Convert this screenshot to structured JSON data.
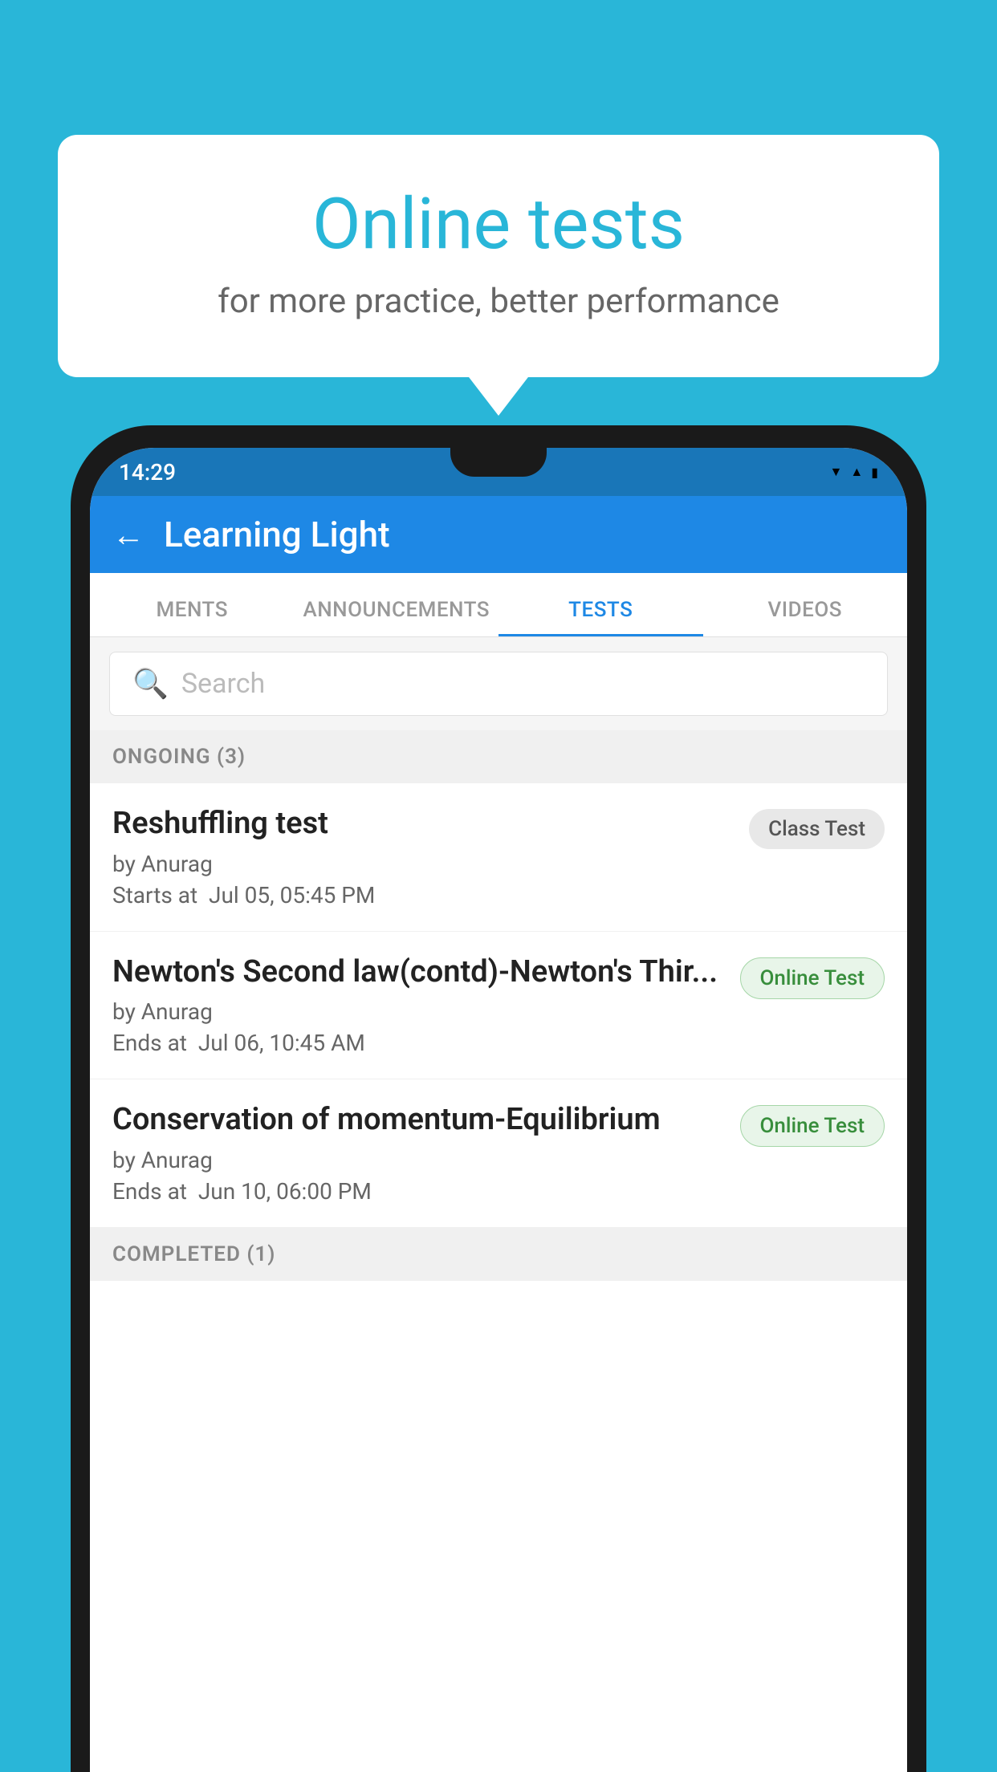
{
  "background_color": "#29b6d8",
  "bubble": {
    "title": "Online tests",
    "subtitle": "for more practice, better performance"
  },
  "status_bar": {
    "time": "14:29",
    "wifi_icon": "▾",
    "signal_icon": "▲",
    "battery_icon": "▮"
  },
  "app_header": {
    "back_label": "←",
    "title": "Learning Light"
  },
  "tabs": [
    {
      "label": "MENTS",
      "active": false
    },
    {
      "label": "ANNOUNCEMENTS",
      "active": false
    },
    {
      "label": "TESTS",
      "active": true
    },
    {
      "label": "VIDEOS",
      "active": false
    }
  ],
  "search": {
    "placeholder": "Search"
  },
  "ongoing_section": {
    "label": "ONGOING (3)"
  },
  "tests": [
    {
      "name": "Reshuffling test",
      "by": "by Anurag",
      "date_label": "Starts at",
      "date": "Jul 05, 05:45 PM",
      "badge": "Class Test",
      "badge_type": "class"
    },
    {
      "name": "Newton's Second law(contd)-Newton's Thir...",
      "by": "by Anurag",
      "date_label": "Ends at",
      "date": "Jul 06, 10:45 AM",
      "badge": "Online Test",
      "badge_type": "online"
    },
    {
      "name": "Conservation of momentum-Equilibrium",
      "by": "by Anurag",
      "date_label": "Ends at",
      "date": "Jun 10, 06:00 PM",
      "badge": "Online Test",
      "badge_type": "online"
    }
  ],
  "completed_section": {
    "label": "COMPLETED (1)"
  }
}
